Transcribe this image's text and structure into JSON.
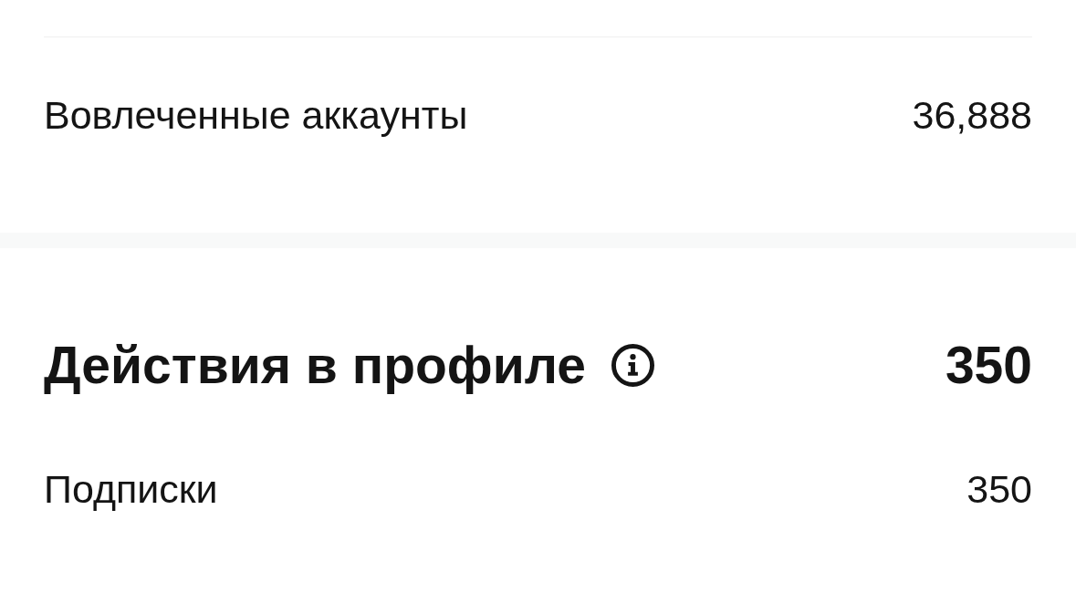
{
  "summary_rows": [
    {
      "label": "Вовлеченные аккаунты",
      "value": "36,888"
    }
  ],
  "section": {
    "title": "Действия в профиле",
    "total": "350",
    "rows": [
      {
        "label": "Подписки",
        "value": "350"
      }
    ]
  }
}
